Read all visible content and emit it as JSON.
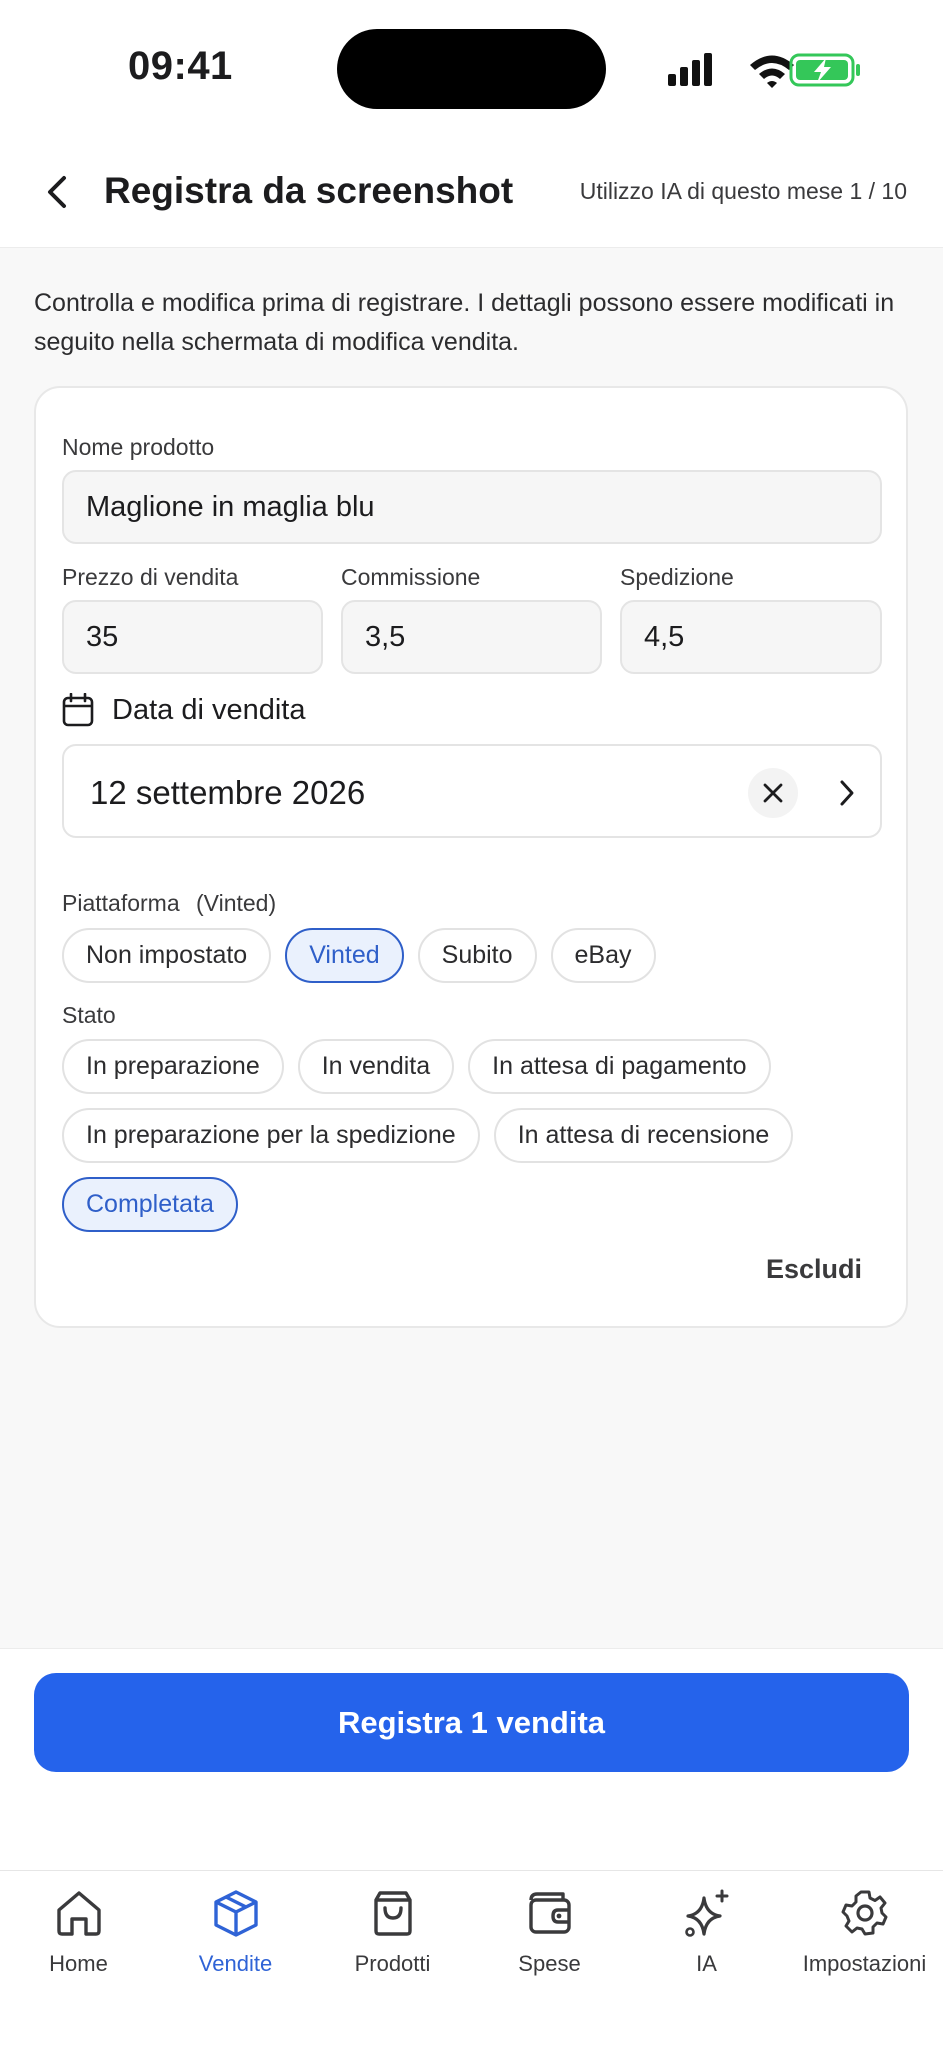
{
  "status_bar": {
    "time": "09:41"
  },
  "header": {
    "title": "Registra da screenshot",
    "usage": "Utilizzo IA di questo mese 1 / 10"
  },
  "description": "Controlla e modifica prima di registrare. I dettagli possono essere modificati in seguito nella schermata di modifica vendita.",
  "form": {
    "product_name_label": "Nome prodotto",
    "product_name_value": "Maglione in maglia blu",
    "price_label": "Prezzo di vendita",
    "price_value": "35",
    "commission_label": "Commissione",
    "commission_value": "3,5",
    "shipping_label": "Spedizione",
    "shipping_value": "4,5",
    "date_label": "Data di vendita",
    "date_value": "12 settembre 2026",
    "platform_label": "Piattaforma",
    "platform_selected_hint": "(Vinted)",
    "platforms": [
      {
        "label": "Non impostato",
        "selected": false
      },
      {
        "label": "Vinted",
        "selected": true
      },
      {
        "label": "Subito",
        "selected": false
      },
      {
        "label": "eBay",
        "selected": false
      }
    ],
    "status_label": "Stato",
    "statuses": [
      {
        "label": "In preparazione",
        "selected": false
      },
      {
        "label": "In vendita",
        "selected": false
      },
      {
        "label": "In attesa di pagamento",
        "selected": false
      },
      {
        "label": "In preparazione per la spedizione",
        "selected": false
      },
      {
        "label": "In attesa di recensione",
        "selected": false
      },
      {
        "label": "Completata",
        "selected": true
      }
    ],
    "exclude_label": "Escludi"
  },
  "primary_action": "Registra 1 vendita",
  "tabs": [
    {
      "label": "Home",
      "icon": "home-icon",
      "active": false
    },
    {
      "label": "Vendite",
      "icon": "box-icon",
      "active": true
    },
    {
      "label": "Prodotti",
      "icon": "shopping-bag-icon",
      "active": false
    },
    {
      "label": "Spese",
      "icon": "wallet-icon",
      "active": false
    },
    {
      "label": "IA",
      "icon": "sparkle-icon",
      "active": false
    },
    {
      "label": "Impostazioni",
      "icon": "gear-icon",
      "active": false
    }
  ],
  "colors": {
    "accent": "#2563eb",
    "selected_chip_border": "#2f5fc9",
    "selected_chip_bg": "#eaf1fd",
    "battery_green": "#34c759"
  }
}
